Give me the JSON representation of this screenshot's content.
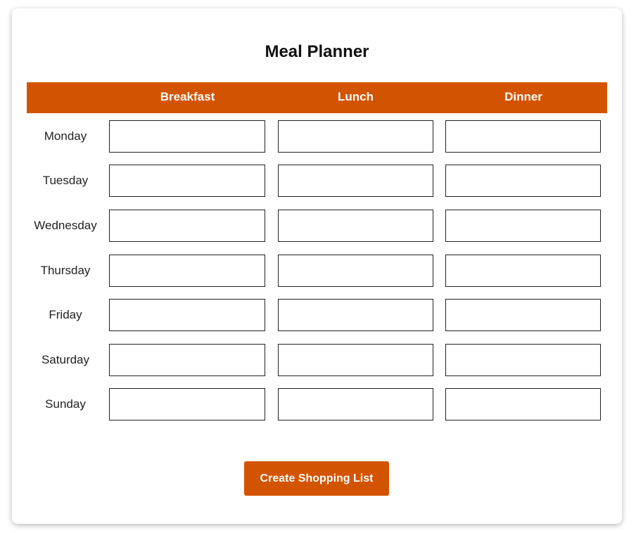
{
  "planner": {
    "title": "Meal Planner",
    "columns": [
      "Breakfast",
      "Lunch",
      "Dinner"
    ],
    "days": [
      "Monday",
      "Tuesday",
      "Wednesday",
      "Thursday",
      "Friday",
      "Saturday",
      "Sunday"
    ],
    "entries": [
      [
        "",
        "",
        ""
      ],
      [
        "",
        "",
        ""
      ],
      [
        "",
        "",
        ""
      ],
      [
        "",
        "",
        ""
      ],
      [
        "",
        "",
        ""
      ],
      [
        "",
        "",
        ""
      ],
      [
        "",
        "",
        ""
      ]
    ],
    "create_button_label": "Create Shopping List"
  },
  "colors": {
    "accent": "#d35400",
    "header_text": "#ffffff"
  }
}
